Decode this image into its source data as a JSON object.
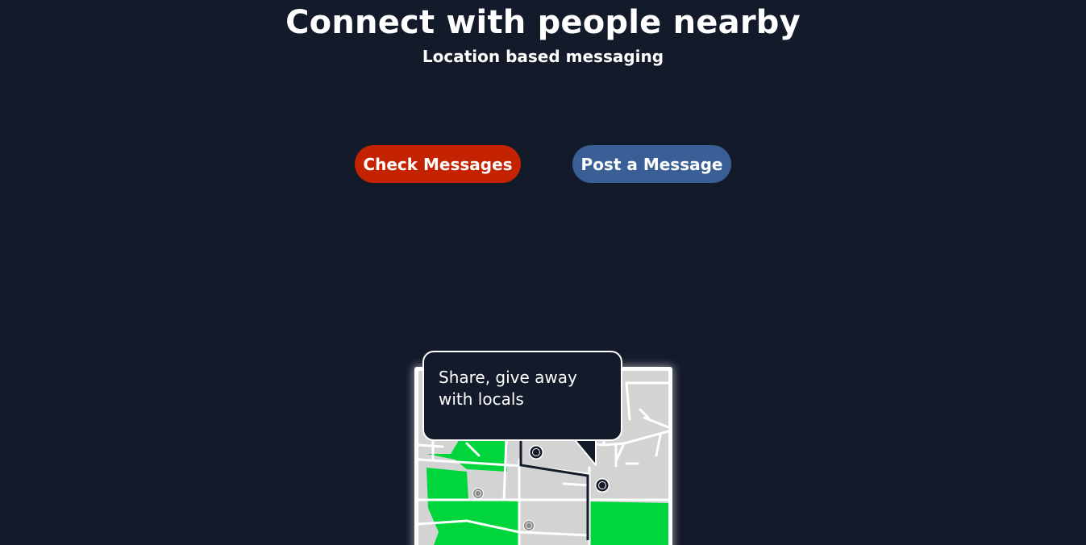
{
  "hero": {
    "title": "Connect with people nearby",
    "subtitle": "Location based messaging"
  },
  "actions": {
    "check_messages_label": "Check Messages",
    "post_message_label": "Post a Message"
  },
  "illustration": {
    "bubble_text": "Share, give away with locals"
  },
  "colors": {
    "background": "#131a2a",
    "check_button": "#c42200",
    "post_button": "#3a5f96",
    "map_green": "#00d63c",
    "map_gray": "#d3d3d3"
  }
}
